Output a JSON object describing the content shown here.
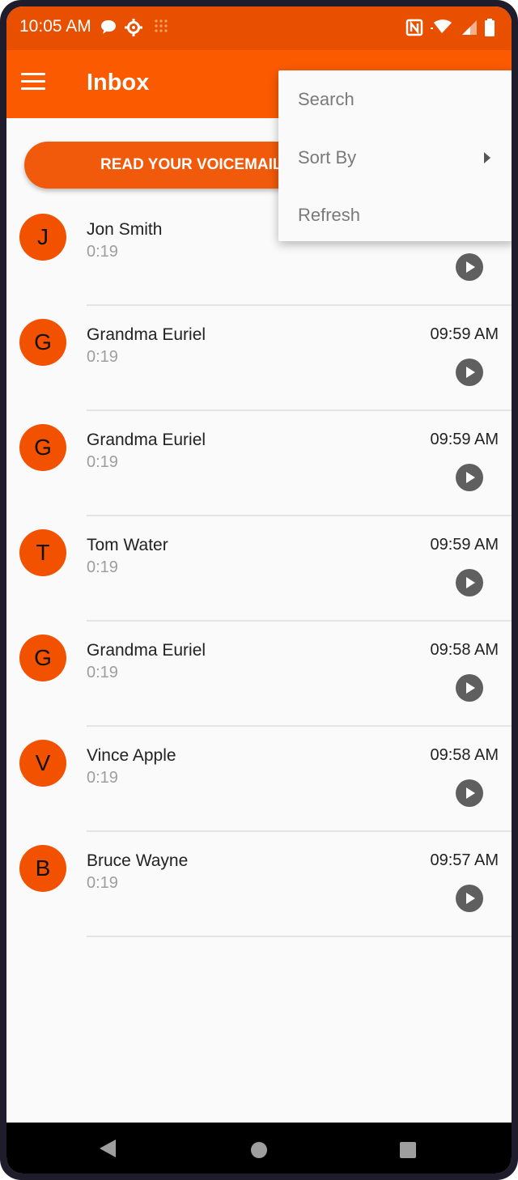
{
  "status_bar": {
    "time": "10:05 AM",
    "icons": [
      "chat-bubble-icon",
      "settings-gear-icon",
      "grid-dots-icon",
      "nfc-icon",
      "wifi-icon",
      "signal-icon",
      "battery-icon"
    ]
  },
  "app_bar": {
    "title": "Inbox",
    "menu_icon": "hamburger-menu-icon"
  },
  "cta": {
    "label": "READ YOUR VOICEMAILS"
  },
  "voicemails": [
    {
      "initial": "J",
      "name": "Jon Smith",
      "duration": "0:19",
      "time": ""
    },
    {
      "initial": "G",
      "name": "Grandma Euriel",
      "duration": "0:19",
      "time": "09:59 AM"
    },
    {
      "initial": "G",
      "name": "Grandma Euriel",
      "duration": "0:19",
      "time": "09:59 AM"
    },
    {
      "initial": "T",
      "name": "Tom Water",
      "duration": "0:19",
      "time": "09:59 AM"
    },
    {
      "initial": "G",
      "name": "Grandma Euriel",
      "duration": "0:19",
      "time": "09:58 AM"
    },
    {
      "initial": "V",
      "name": "Vince Apple",
      "duration": "0:19",
      "time": "09:58 AM"
    },
    {
      "initial": "B",
      "name": "Bruce Wayne",
      "duration": "0:19",
      "time": "09:57 AM"
    }
  ],
  "overflow_menu": {
    "items": [
      {
        "label": "Search",
        "has_submenu": false
      },
      {
        "label": "Sort By",
        "has_submenu": true
      },
      {
        "label": "Refresh",
        "has_submenu": false
      }
    ]
  },
  "colors": {
    "status_bar": "#e85000",
    "app_bar": "#fb5a00",
    "accent": "#f25100",
    "play_button": "#5f5f5f"
  },
  "nav_bar": {
    "icons": [
      "back-icon",
      "home-icon",
      "recents-icon"
    ]
  }
}
